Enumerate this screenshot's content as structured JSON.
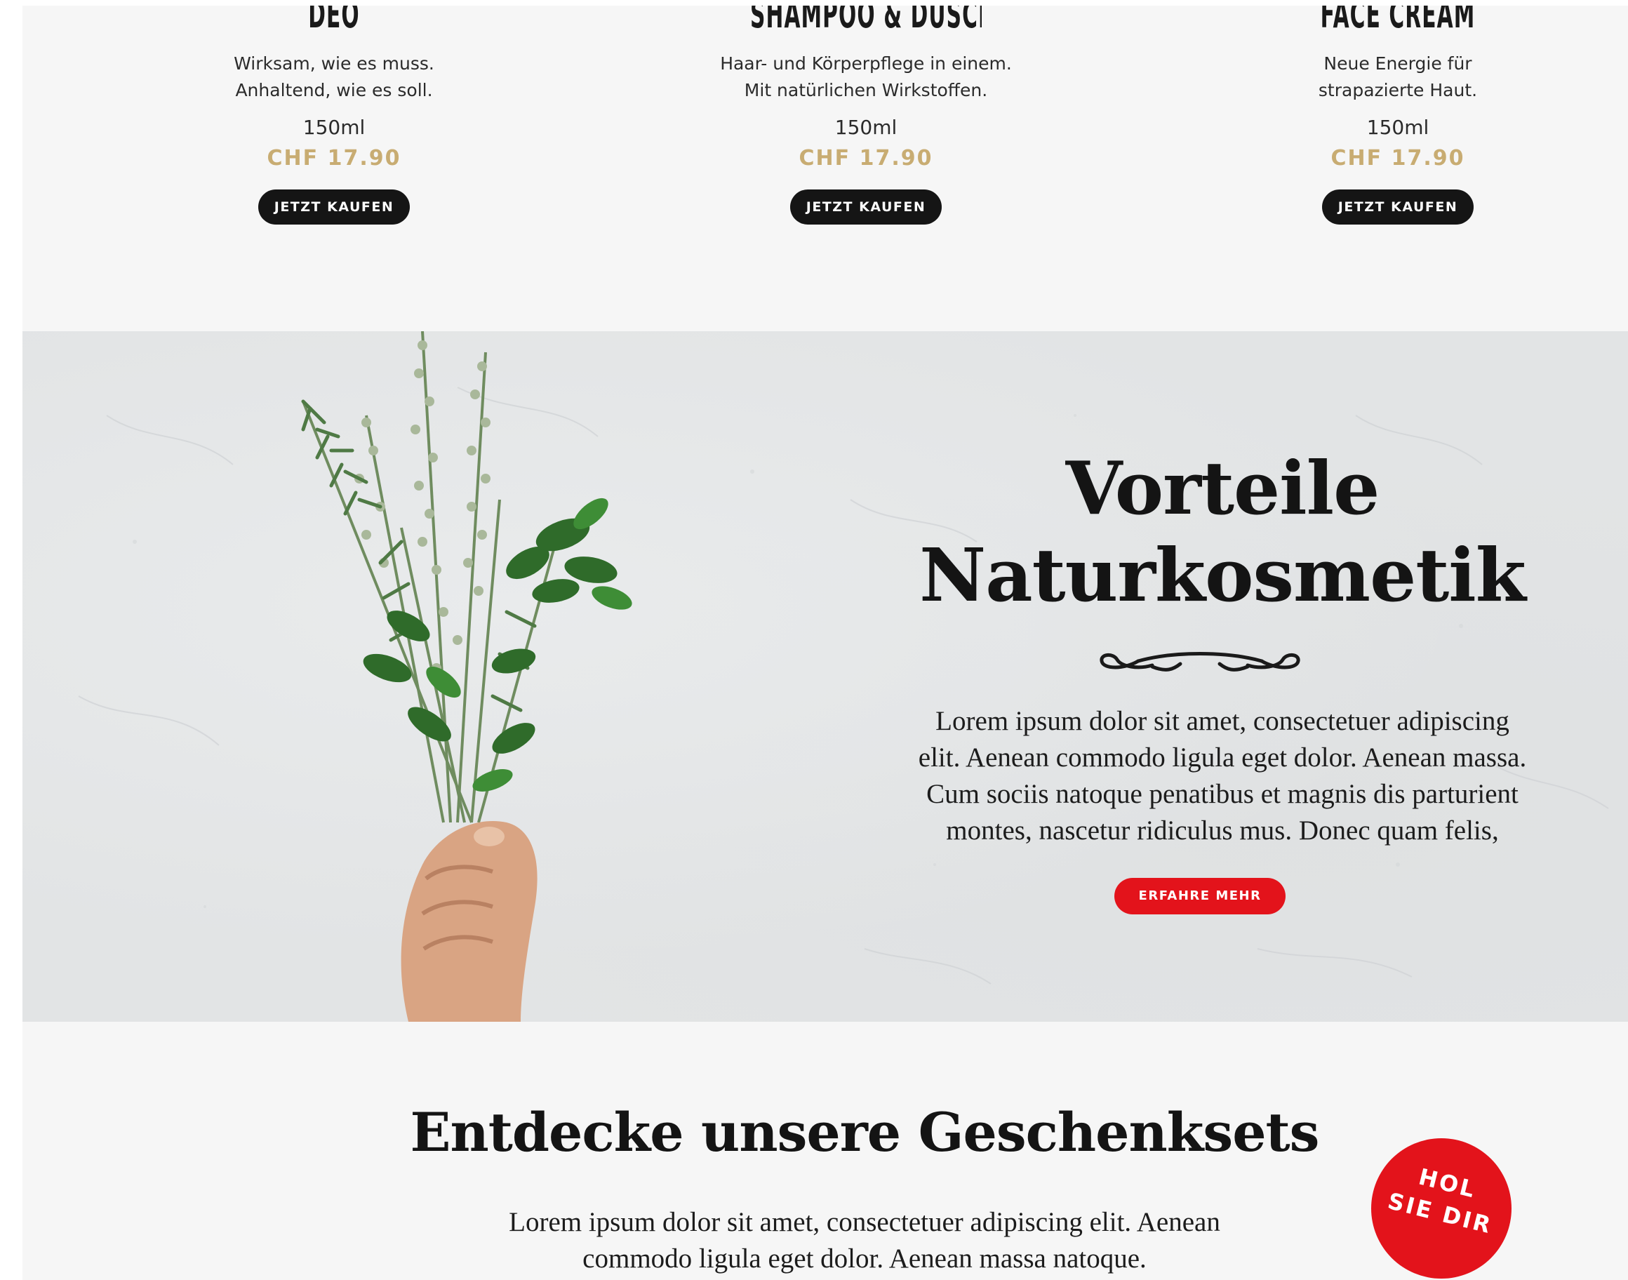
{
  "products": [
    {
      "name": "DEO",
      "desc_lines": [
        "Wirksam, wie es muss.",
        "Anhaltend, wie es soll."
      ],
      "size": "150ml",
      "price": "CHF 17.90",
      "button": "JETZT KAUFEN"
    },
    {
      "name": "SHAMPOO & DUSCH",
      "desc_lines": [
        "Haar- und Körperpflege in einem.",
        "Mit natürlichen Wirkstoffen."
      ],
      "size": "150ml",
      "price": "CHF 17.90",
      "button": "JETZT KAUFEN"
    },
    {
      "name": "FACE CREAM",
      "desc_lines": [
        "Neue Energie für",
        "strapazierte Haut."
      ],
      "size": "150ml",
      "price": "CHF 17.90",
      "button": "JETZT KAUFEN"
    }
  ],
  "hero": {
    "title_lines": [
      "Vorteile",
      "Naturkosmetik"
    ],
    "text_lines": [
      "Lorem ipsum dolor sit amet, consectetuer adipiscing",
      "elit. Aenean commodo ligula eget dolor. Aenean massa.",
      "Cum sociis natoque penatibus et magnis dis parturient",
      "montes, nascetur ridiculus mus. Donec quam felis,"
    ],
    "button": "ERFAHRE MEHR"
  },
  "gifts": {
    "title": "Entdecke unsere Geschenksets",
    "text_lines": [
      "Lorem ipsum dolor sit amet, consectetuer adipiscing elit. Aenean",
      "commodo ligula eget dolor. Aenean massa natoque."
    ],
    "badge_lines": [
      "HOL",
      "SIE DIR"
    ]
  },
  "colors": {
    "price_gold": "#c8ac72",
    "button_dark": "#151515",
    "accent_red": "#e3131b",
    "page_bg": "#f6f6f6"
  }
}
